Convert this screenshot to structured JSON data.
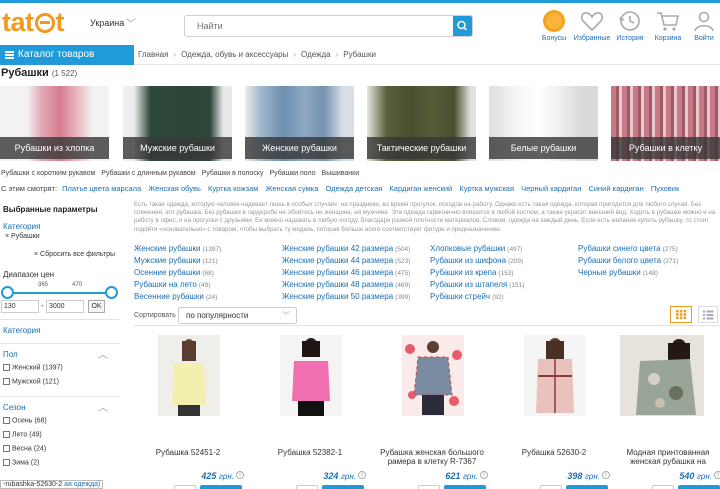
{
  "header": {
    "logo": "tat",
    "logo_suffix": "t",
    "region": "Украина",
    "search_placeholder": "Найти",
    "icons": [
      {
        "label": "Бонусы",
        "icon": "sun-bonus-icon",
        "color": "#f29a1f"
      },
      {
        "label": "Избранные",
        "icon": "heart-icon"
      },
      {
        "label": "История",
        "icon": "history-clock-icon"
      },
      {
        "label": "Корзина",
        "icon": "cart-icon"
      },
      {
        "label": "Войти",
        "icon": "user-icon"
      }
    ]
  },
  "nav": {
    "catalog_label": "Каталог товаров",
    "breadcrumbs": [
      "Главная",
      "Одежда, обувь и аксессуары",
      "Одежда",
      "Рубашки"
    ]
  },
  "page": {
    "title": "Рубашки",
    "count": "(1 522)"
  },
  "tiles": [
    {
      "label": "Рубашки из хлопка"
    },
    {
      "label": "Мужские рубашки"
    },
    {
      "label": "Женские рубашки"
    },
    {
      "label": "Тактические рубашки"
    },
    {
      "label": "Белые рубашки"
    },
    {
      "label": "Рубашки в клетку"
    }
  ],
  "sublinks": [
    "Рубашки с коротким рукавом",
    "Рубашки с длинным рукавом",
    "Рубашки в полоску",
    "Рубашки поло",
    "Вышиванки"
  ],
  "related": {
    "label": "С этим смотрят:",
    "items": [
      "Платье цвета марсала",
      "Женская обувь",
      "Куртка кожзам",
      "Женская сумка",
      "Одежда детская",
      "Кардиган женский",
      "Куртка мужская",
      "Черный кардиган",
      "Синий кардиган",
      "Пуховик"
    ]
  },
  "sidebar": {
    "selected_title": "Выбранные параметры",
    "category_label": "Категория",
    "selected_tag": "× Рубашки",
    "reset_label": "× Сбросить все фильтры",
    "price_title": "Диапазон цен",
    "tick_low": "365",
    "tick_high": "470",
    "price_min": "130",
    "price_max": "3000",
    "ok_label": "OK",
    "category_section": "Категория",
    "gender_section": "Пол",
    "gender_options": [
      {
        "label": "Женский",
        "count": "(1397)"
      },
      {
        "label": "Мужской",
        "count": "(121)"
      }
    ],
    "season_section": "Сезон",
    "season_options": [
      {
        "label": "Осень",
        "count": "(68)"
      },
      {
        "label": "Лето",
        "count": "(49)"
      },
      {
        "label": "Весна",
        "count": "(24)"
      },
      {
        "label": "Зима",
        "count": "(2)"
      }
    ],
    "tooltip_text": "-rubashka-52630-2",
    "tooltip_more": "ая одежда)"
  },
  "content": {
    "description": "Есть такая одежда, которую человек надевает лишь в особых случаях: на праздники, во время прогулок, походов на работу. Однако есть такая одежда, которая пригодится для любого случая. Без сомнения, это рубашка. Без рубашки в гардеробе не обойтись ни женщине, ни мужчине. Эта одежда гармонично впишется в любой костюм, а также украсит внешний вид. Ходить в рубашке можно и на работу в офис, и на прогулки с друзьями. Ее можно надевать в любую погоду, благодаря разной плотности материалов. Словом, одежда на каждый день. Если есть желание купить рубашку, то стоит подойти «основательно» с товаром, чтобы выбрать ту модель, которая больше всего соответствует фигуре и предназначению.",
    "link_columns": [
      [
        {
          "text": "Женские рубашки",
          "count": "(1397)"
        },
        {
          "text": "Мужские рубашки",
          "count": "(121)"
        },
        {
          "text": "Осенние рубашки",
          "count": "(68)"
        },
        {
          "text": "Рубашки на лето",
          "count": "(49)"
        },
        {
          "text": "Весенние рубашки",
          "count": "(24)"
        }
      ],
      [
        {
          "text": "Женские рубашки 42 размера",
          "count": "(504)"
        },
        {
          "text": "Женские рубашки 44 размера",
          "count": "(523)"
        },
        {
          "text": "Женские рубашки 46 размера",
          "count": "(475)"
        },
        {
          "text": "Женские рубашки 48 размера",
          "count": "(469)"
        },
        {
          "text": "Женские рубашки 50 размера",
          "count": "(399)"
        }
      ],
      [
        {
          "text": "Хлопковые рубашки",
          "count": "(497)"
        },
        {
          "text": "Рубашки из шифона",
          "count": "(209)"
        },
        {
          "text": "Рубашки из крепа",
          "count": "(153)"
        },
        {
          "text": "Рубашки из штапеля",
          "count": "(151)"
        },
        {
          "text": "Рубашки стрейч",
          "count": "(92)"
        }
      ],
      [
        {
          "text": "Рубашки синего цвета",
          "count": "(275)"
        },
        {
          "text": "Рубашки белого цвета",
          "count": "(271)"
        },
        {
          "text": "Черные рубашки",
          "count": "(148)"
        }
      ]
    ],
    "sort_label": "Сортировать",
    "sort_value": "по популярности"
  },
  "products": [
    {
      "name": "Рубашка 52451-2",
      "price": "425",
      "currency": "грн."
    },
    {
      "name": "Рубашка 52382-1",
      "price": "324",
      "currency": "грн."
    },
    {
      "name": "Рубашка женская большого рамера в клетку R-7367",
      "price": "621",
      "currency": "грн."
    },
    {
      "name": "Рубашка 52630-2",
      "price": "398",
      "currency": "грн."
    },
    {
      "name": "Модная принтованная женская рубашка на",
      "price": "540",
      "currency": "грн."
    }
  ],
  "colors": {
    "accent_blue": "#1e9bd8",
    "link_blue": "#1a6fb5",
    "logo_orange": "#f29a1f"
  }
}
